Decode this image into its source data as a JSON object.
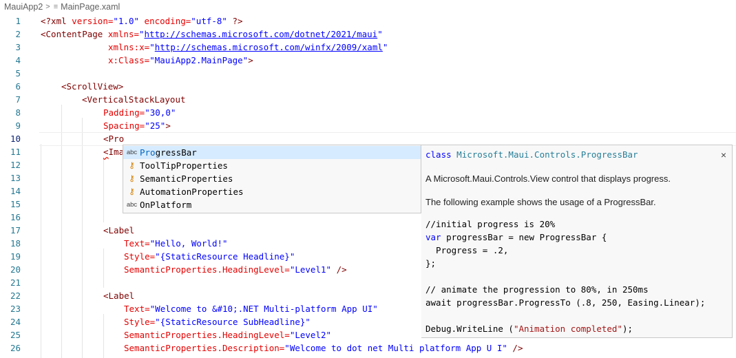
{
  "breadcrumb": {
    "project": "MauiApp2",
    "file": "MainPage.xaml"
  },
  "current_line": 10,
  "lines": [
    {
      "n": "1"
    },
    {
      "n": "2"
    },
    {
      "n": "3"
    },
    {
      "n": "4"
    },
    {
      "n": "5"
    },
    {
      "n": "6"
    },
    {
      "n": "7"
    },
    {
      "n": "8"
    },
    {
      "n": "9"
    },
    {
      "n": "10"
    },
    {
      "n": "11"
    },
    {
      "n": "12"
    },
    {
      "n": "13"
    },
    {
      "n": "14"
    },
    {
      "n": "15"
    },
    {
      "n": "16"
    },
    {
      "n": "17"
    },
    {
      "n": "18"
    },
    {
      "n": "19"
    },
    {
      "n": "20"
    },
    {
      "n": "21"
    },
    {
      "n": "22"
    },
    {
      "n": "23"
    },
    {
      "n": "24"
    },
    {
      "n": "25"
    },
    {
      "n": "26"
    }
  ],
  "code": {
    "l1": [
      "<?xml",
      " version=",
      "\"1.0\"",
      " encoding=",
      "\"utf-8\"",
      " ?>"
    ],
    "l2": [
      "<ContentPage",
      " xmlns=",
      "\"",
      "http://schemas.microsoft.com/dotnet/2021/maui",
      "\""
    ],
    "l3": [
      "xmlns:x=",
      "\"",
      "http://schemas.microsoft.com/winfx/2009/xaml",
      "\""
    ],
    "l4": [
      "x:Class=",
      "\"MauiApp2.MainPage\"",
      ">"
    ],
    "l6": [
      "<ScrollView>"
    ],
    "l7": [
      "<VerticalStackLayout"
    ],
    "l8": [
      "Padding=",
      "\"30,0\""
    ],
    "l9": [
      "Spacing=",
      "\"25\"",
      ">"
    ],
    "l10": [
      "<",
      "Pro"
    ],
    "l11": [
      "<",
      "Ima"
    ],
    "l17": [
      "<Label"
    ],
    "l18": [
      "Text=",
      "\"Hello, World!\""
    ],
    "l19": [
      "Style=",
      "\"{StaticResource Headline}\""
    ],
    "l20": [
      "SemanticProperties.HeadingLevel=",
      "\"Level1\"",
      " />"
    ],
    "l22": [
      "<Label"
    ],
    "l23": [
      "Text=",
      "\"Welcome to &#10;.NET Multi-platform App UI\""
    ],
    "l24": [
      "Style=",
      "\"{StaticResource SubHeadline}\""
    ],
    "l25": [
      "SemanticProperties.HeadingLevel=",
      "\"Level2\""
    ],
    "l26": [
      "SemanticProperties.Description=",
      "\"Welcome to dot net Multi platform App U I\"",
      " />"
    ]
  },
  "suggestions": [
    {
      "icon": "abc",
      "icon_name": "text-snippet-icon",
      "match": "Pro",
      "rest": "gressBar",
      "selected": true
    },
    {
      "icon": "⚷",
      "icon_name": "property-icon",
      "label": "ToolTipProperties"
    },
    {
      "icon": "⚷",
      "icon_name": "property-icon",
      "label": "SemanticProperties"
    },
    {
      "icon": "⚷",
      "icon_name": "property-icon",
      "label": "AutomationProperties"
    },
    {
      "icon": "abc",
      "icon_name": "text-snippet-icon",
      "label": "OnPlatform"
    }
  ],
  "details": {
    "sig_kw": "class",
    "sig_ns": "Microsoft",
    "sig_rest": ".Maui.Controls.ProgressBar",
    "close": "×",
    "desc1": "A Microsoft.Maui.Controls.View control that displays progress.",
    "desc2": "The following example shows the usage of a ProgressBar.",
    "code": {
      "c1": "//initial progress is 20%",
      "c2a": "var",
      "c2b": " progressBar = new ProgressBar {",
      "c3": "  Progress = .2,",
      "c4": "};",
      "c6": "// animate the progression to 80%, in 250ms",
      "c7": "await progressBar.ProgressTo (.8, 250, Easing.Linear);",
      "c9a": "Debug.WriteLine (",
      "c9b": "\"Animation completed\"",
      "c9c": ");"
    }
  }
}
